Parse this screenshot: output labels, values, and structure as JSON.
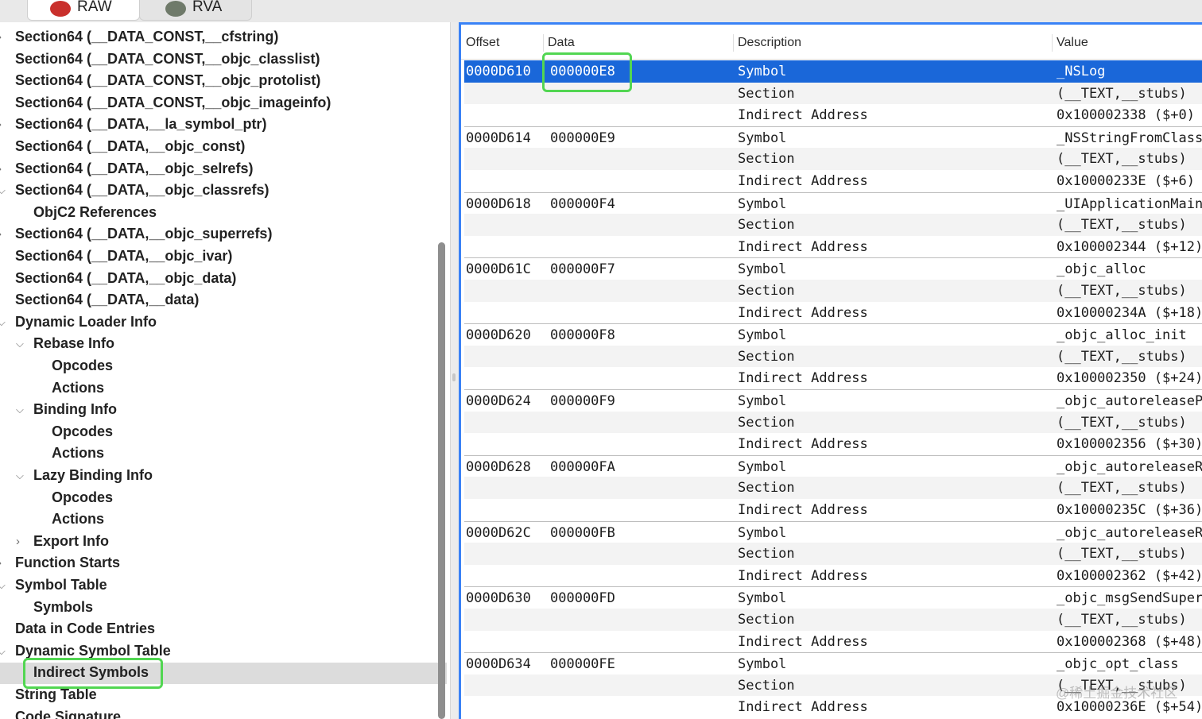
{
  "tabs": [
    {
      "label": "RAW",
      "icon": "app-icon"
    },
    {
      "label": "RVA",
      "icon": "app-icon"
    }
  ],
  "tree": [
    {
      "label": "Section64 (__DATA_CONST,__cfstring)",
      "depth": 0,
      "disclosure": "collapsed"
    },
    {
      "label": "Section64 (__DATA_CONST,__objc_classlist)",
      "depth": 0,
      "disclosure": "none"
    },
    {
      "label": "Section64 (__DATA_CONST,__objc_protolist)",
      "depth": 0,
      "disclosure": "none"
    },
    {
      "label": "Section64 (__DATA_CONST,__objc_imageinfo)",
      "depth": 0,
      "disclosure": "none"
    },
    {
      "label": "Section64 (__DATA,__la_symbol_ptr)",
      "depth": 0,
      "disclosure": "collapsed"
    },
    {
      "label": "Section64 (__DATA,__objc_const)",
      "depth": 0,
      "disclosure": "none"
    },
    {
      "label": "Section64 (__DATA,__objc_selrefs)",
      "depth": 0,
      "disclosure": "collapsed"
    },
    {
      "label": "Section64 (__DATA,__objc_classrefs)",
      "depth": 0,
      "disclosure": "expanded"
    },
    {
      "label": "ObjC2 References",
      "depth": 1,
      "disclosure": "none"
    },
    {
      "label": "Section64 (__DATA,__objc_superrefs)",
      "depth": 0,
      "disclosure": "collapsed"
    },
    {
      "label": "Section64 (__DATA,__objc_ivar)",
      "depth": 0,
      "disclosure": "none"
    },
    {
      "label": "Section64 (__DATA,__objc_data)",
      "depth": 0,
      "disclosure": "none"
    },
    {
      "label": "Section64 (__DATA,__data)",
      "depth": 0,
      "disclosure": "none"
    },
    {
      "label": "Dynamic Loader Info",
      "depth": 0,
      "disclosure": "expanded"
    },
    {
      "label": "Rebase Info",
      "depth": 1,
      "disclosure": "expanded"
    },
    {
      "label": "Opcodes",
      "depth": 2,
      "disclosure": "none"
    },
    {
      "label": "Actions",
      "depth": 2,
      "disclosure": "none"
    },
    {
      "label": "Binding Info",
      "depth": 1,
      "disclosure": "expanded"
    },
    {
      "label": "Opcodes",
      "depth": 2,
      "disclosure": "none"
    },
    {
      "label": "Actions",
      "depth": 2,
      "disclosure": "none"
    },
    {
      "label": "Lazy Binding Info",
      "depth": 1,
      "disclosure": "expanded"
    },
    {
      "label": "Opcodes",
      "depth": 2,
      "disclosure": "none"
    },
    {
      "label": "Actions",
      "depth": 2,
      "disclosure": "none"
    },
    {
      "label": "Export Info",
      "depth": 1,
      "disclosure": "collapsed"
    },
    {
      "label": "Function Starts",
      "depth": 0,
      "disclosure": "collapsed"
    },
    {
      "label": "Symbol Table",
      "depth": 0,
      "disclosure": "expanded"
    },
    {
      "label": "Symbols",
      "depth": 1,
      "disclosure": "none"
    },
    {
      "label": "Data in Code Entries",
      "depth": 0,
      "disclosure": "none"
    },
    {
      "label": "Dynamic Symbol Table",
      "depth": 0,
      "disclosure": "expanded"
    },
    {
      "label": "Indirect Symbols",
      "depth": 1,
      "disclosure": "none",
      "selected": true
    },
    {
      "label": "String Table",
      "depth": 0,
      "disclosure": "none"
    },
    {
      "label": "Code Signature",
      "depth": 0,
      "disclosure": "none"
    }
  ],
  "table": {
    "headers": [
      "Offset",
      "Data",
      "Description",
      "Value"
    ],
    "groups": [
      {
        "offset": "0000D610",
        "data": "000000E8",
        "symbol": "_NSLog",
        "section": "(__TEXT,__stubs)",
        "address": "0x100002338 ($+0)"
      },
      {
        "offset": "0000D614",
        "data": "000000E9",
        "symbol": "_NSStringFromClass",
        "section": "(__TEXT,__stubs)",
        "address": "0x10000233E ($+6)"
      },
      {
        "offset": "0000D618",
        "data": "000000F4",
        "symbol": "_UIApplicationMain",
        "section": "(__TEXT,__stubs)",
        "address": "0x100002344 ($+12)"
      },
      {
        "offset": "0000D61C",
        "data": "000000F7",
        "symbol": "_objc_alloc",
        "section": "(__TEXT,__stubs)",
        "address": "0x10000234A ($+18)"
      },
      {
        "offset": "0000D620",
        "data": "000000F8",
        "symbol": "_objc_alloc_init",
        "section": "(__TEXT,__stubs)",
        "address": "0x100002350 ($+24)"
      },
      {
        "offset": "0000D624",
        "data": "000000F9",
        "symbol": "_objc_autoreleaseP",
        "section": "(__TEXT,__stubs)",
        "address": "0x100002356 ($+30)"
      },
      {
        "offset": "0000D628",
        "data": "000000FA",
        "symbol": "_objc_autoreleaseR",
        "section": "(__TEXT,__stubs)",
        "address": "0x10000235C ($+36)"
      },
      {
        "offset": "0000D62C",
        "data": "000000FB",
        "symbol": "_objc_autoreleaseR",
        "section": "(__TEXT,__stubs)",
        "address": "0x100002362 ($+42)"
      },
      {
        "offset": "0000D630",
        "data": "000000FD",
        "symbol": "_objc_msgSendSuper",
        "section": "(__TEXT,__stubs)",
        "address": "0x100002368 ($+48)"
      },
      {
        "offset": "0000D634",
        "data": "000000FE",
        "symbol": "_objc_opt_class",
        "section": "(__TEXT,__stubs)",
        "address": "0x10000236E ($+54)"
      }
    ],
    "desc_labels": [
      "Symbol",
      "Section",
      "Indirect Address"
    ],
    "selected_group": 0
  },
  "watermark": "@稀土掘金技术社区",
  "colors": {
    "selection": "#1a67d9",
    "highlight": "#52d652",
    "focus_border": "#3a82f6"
  }
}
